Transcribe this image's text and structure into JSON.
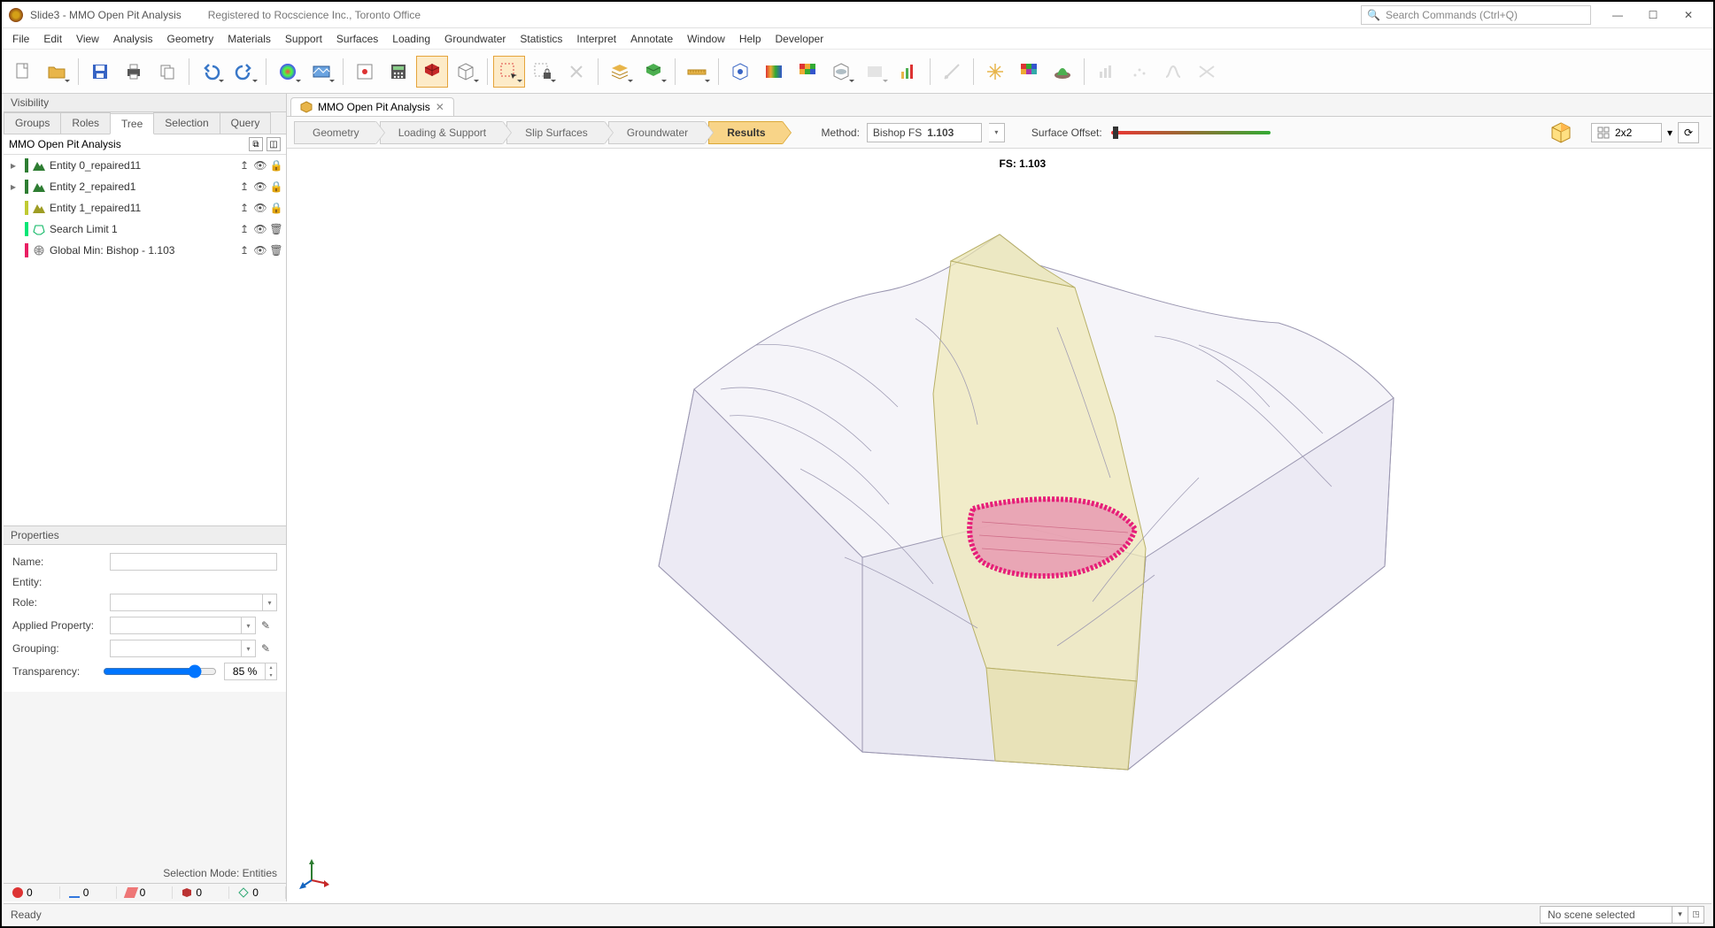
{
  "title": {
    "app": "Slide3 - MMO Open Pit Analysis",
    "registered": "Registered to Rocscience Inc., Toronto Office",
    "search_placeholder": "Search Commands (Ctrl+Q)"
  },
  "menu": [
    "File",
    "Edit",
    "View",
    "Analysis",
    "Geometry",
    "Materials",
    "Support",
    "Surfaces",
    "Loading",
    "Groundwater",
    "Statistics",
    "Interpret",
    "Annotate",
    "Window",
    "Help",
    "Developer"
  ],
  "visibility": {
    "panel_title": "Visibility",
    "tabs": [
      "Groups",
      "Roles",
      "Tree",
      "Selection",
      "Query"
    ],
    "active_tab": "Tree",
    "header": "MMO Open Pit Analysis",
    "items": [
      {
        "label": "Entity 0_repaired11",
        "color": "#2e7d32",
        "expandable": true,
        "icons": [
          "arrow",
          "eye",
          "lock"
        ]
      },
      {
        "label": "Entity 2_repaired1",
        "color": "#2e7d32",
        "expandable": true,
        "icons": [
          "arrow",
          "eye",
          "lock"
        ]
      },
      {
        "label": "Entity 1_repaired11",
        "color": "#c0ca33",
        "expandable": false,
        "icons": [
          "arrow",
          "eye",
          "lock"
        ]
      },
      {
        "label": "Search Limit 1",
        "color": "#00e676",
        "expandable": false,
        "icons": [
          "arrow",
          "eye",
          "trash"
        ],
        "shape": "poly"
      },
      {
        "label": "Global Min: Bishop  -  1.103",
        "color": "#e91e63",
        "expandable": false,
        "icons": [
          "arrow",
          "eye",
          "trash"
        ],
        "shape": "globe"
      }
    ]
  },
  "properties": {
    "panel_title": "Properties",
    "name_label": "Name:",
    "entity_label": "Entity:",
    "role_label": "Role:",
    "applied_label": "Applied Property:",
    "grouping_label": "Grouping:",
    "transparency_label": "Transparency:",
    "transparency_value": "85 %"
  },
  "selection_mode": "Selection Mode: Entities",
  "counters": [
    {
      "icon": "point",
      "color": "#d33",
      "value": "0"
    },
    {
      "icon": "line",
      "color": "#37d",
      "value": "0"
    },
    {
      "icon": "face",
      "color": "#e77",
      "value": "0"
    },
    {
      "icon": "cube",
      "color": "#b33",
      "value": "0"
    },
    {
      "icon": "mesh",
      "color": "#3a7",
      "value": "0"
    }
  ],
  "doc_tab": {
    "label": "MMO Open Pit Analysis"
  },
  "workflow": {
    "steps": [
      "Geometry",
      "Loading & Support",
      "Slip Surfaces",
      "Groundwater",
      "Results"
    ],
    "active": "Results",
    "method_label": "Method:",
    "method_value": "Bishop FS",
    "method_fs": "1.103",
    "offset_label": "Surface Offset:"
  },
  "layout_combo": "2x2",
  "viewport": {
    "fs_label": "FS: 1.103"
  },
  "status": {
    "ready": "Ready",
    "scene": "No scene selected"
  }
}
